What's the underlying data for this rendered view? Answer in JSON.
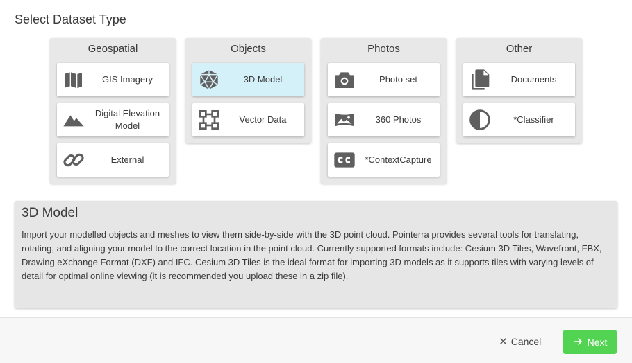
{
  "page_title": "Select Dataset Type",
  "groups": [
    {
      "title": "Geospatial",
      "items": [
        {
          "label": "GIS Imagery",
          "icon": "map-icon"
        },
        {
          "label": "Digital Elevation Model",
          "icon": "terrain-icon"
        },
        {
          "label": "External",
          "icon": "link-icon"
        }
      ]
    },
    {
      "title": "Objects",
      "items": [
        {
          "label": "3D Model",
          "icon": "polyhedron-icon",
          "selected": true
        },
        {
          "label": "Vector Data",
          "icon": "vector-square-icon"
        }
      ]
    },
    {
      "title": "Photos",
      "items": [
        {
          "label": "Photo set",
          "icon": "camera-icon"
        },
        {
          "label": "360 Photos",
          "icon": "panorama-icon"
        },
        {
          "label": "*ContextCapture",
          "icon": "cc-badge-icon"
        }
      ]
    },
    {
      "title": "Other",
      "items": [
        {
          "label": "Documents",
          "icon": "documents-icon"
        },
        {
          "label": "*Classifier",
          "icon": "contrast-icon"
        }
      ]
    }
  ],
  "description": {
    "title": "3D Model",
    "text": "Import your modelled objects and meshes to view them side-by-side with the 3D point cloud. Pointerra provides several tools for translating, rotating, and aligning your model to the correct location in the point cloud. Currently supported formats include: Cesium 3D Tiles, Wavefront, FBX, Drawing eXchange Format (DXF) and IFC. Cesium 3D Tiles is the ideal format for importing 3D models as it supports tiles with varying levels of detail for optimal online viewing (it is recommended you upload these in a zip file)."
  },
  "footer": {
    "cancel_label": "Cancel",
    "next_label": "Next"
  },
  "colors": {
    "icon": "#5f5f5f",
    "selected_card": "#d4f0f8",
    "next_button": "#52d452"
  }
}
